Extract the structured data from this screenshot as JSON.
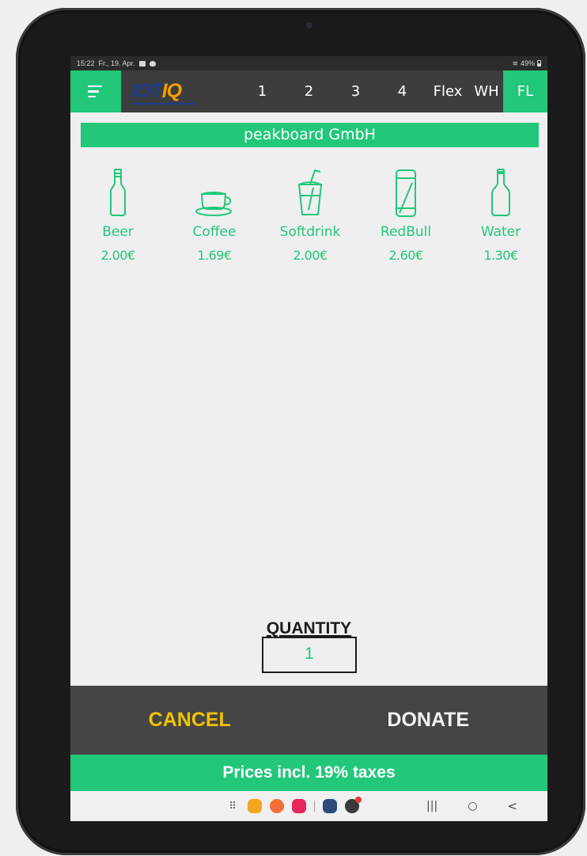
{
  "status_bar": {
    "time": "15:22",
    "date": "Fr., 19. Apr.",
    "battery": "49%"
  },
  "nav": {
    "logo_part1": "IOT",
    "logo_part2": "IQ",
    "tabs": [
      {
        "label": "1",
        "active": false
      },
      {
        "label": "2",
        "active": false
      },
      {
        "label": "3",
        "active": false
      },
      {
        "label": "4",
        "active": false
      },
      {
        "label": "Flex",
        "active": false
      },
      {
        "label": "WH",
        "active": false
      },
      {
        "label": "FL",
        "active": true
      }
    ]
  },
  "company": "peakboard GmbH",
  "products": [
    {
      "name": "Beer",
      "price": "2.00€",
      "icon": "beer-bottle-icon"
    },
    {
      "name": "Coffee",
      "price": "1.69€",
      "icon": "coffee-cup-icon"
    },
    {
      "name": "Softdrink",
      "price": "2.00€",
      "icon": "softdrink-cup-icon"
    },
    {
      "name": "RedBull",
      "price": "2.60€",
      "icon": "can-icon"
    },
    {
      "name": "Water",
      "price": "1.30€",
      "icon": "water-bottle-icon"
    }
  ],
  "quantity": {
    "label": "QUANTITY",
    "value": "1"
  },
  "actions": {
    "cancel": "CANCEL",
    "donate": "DONATE"
  },
  "footer": "Prices incl. 19% taxes",
  "colors": {
    "accent_green": "#22c779",
    "cancel_yellow": "#f2c200",
    "bar_dark": "#3d3d3d"
  }
}
